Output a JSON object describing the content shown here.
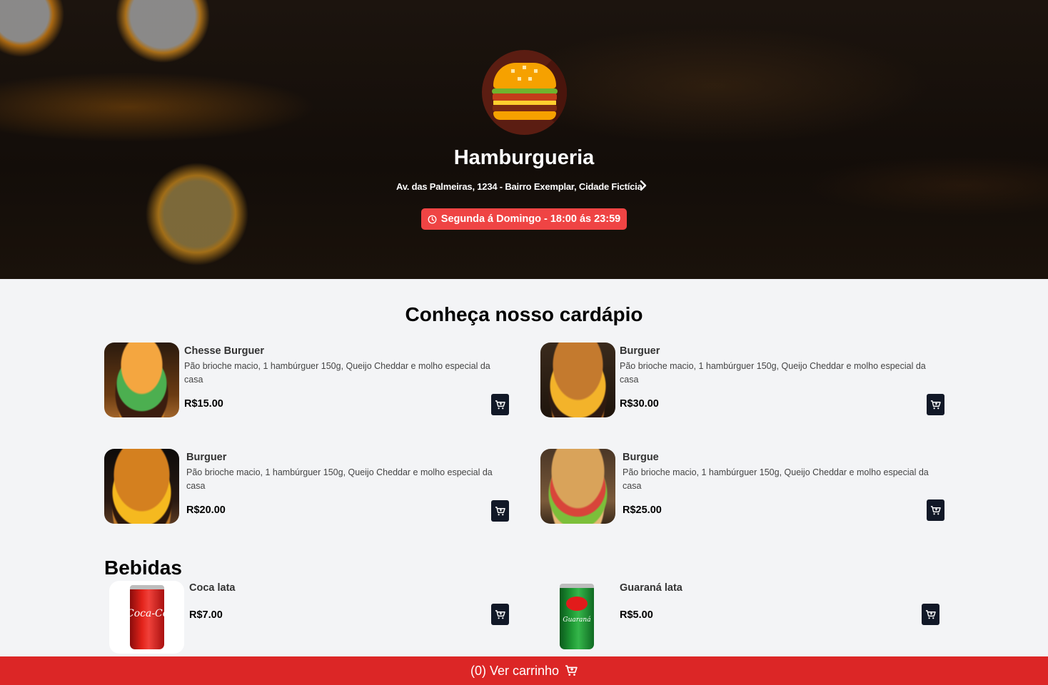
{
  "header": {
    "title": "Hamburgueria",
    "address": "Av. das Palmeiras, 1234 - Bairro Exemplar, Cidade Fictícia",
    "hours": "Segunda á Domingo - 18:00 ás 23:59"
  },
  "menu": {
    "title": "Conheça nosso cardápio",
    "items": [
      {
        "name": "Chesse Burguer",
        "description": "Pão brioche macio, 1 hambúrguer 150g, Queijo Cheddar e molho especial da casa",
        "price": "R$15.00"
      },
      {
        "name": "Burguer",
        "description": "Pão brioche macio, 1 hambúrguer 150g, Queijo Cheddar e molho especial da casa",
        "price": "R$30.00"
      },
      {
        "name": "Burguer",
        "description": "Pão brioche macio, 1 hambúrguer 150g, Queijo Cheddar e molho especial da casa",
        "price": "R$20.00"
      },
      {
        "name": "Burgue",
        "description": "Pão brioche macio, 1 hambúrguer 150g, Queijo Cheddar e molho especial da casa",
        "price": "R$25.00"
      }
    ]
  },
  "drinks": {
    "title": "Bebidas",
    "items": [
      {
        "name": "Coca lata",
        "price": "R$7.00"
      },
      {
        "name": "Guaraná lata",
        "price": "R$5.00"
      }
    ]
  },
  "cart": {
    "label": "(0) Ver carrinho"
  },
  "colors": {
    "accent_red": "#ef4444",
    "footer_red": "#dc2626",
    "button_dark": "#111827"
  }
}
